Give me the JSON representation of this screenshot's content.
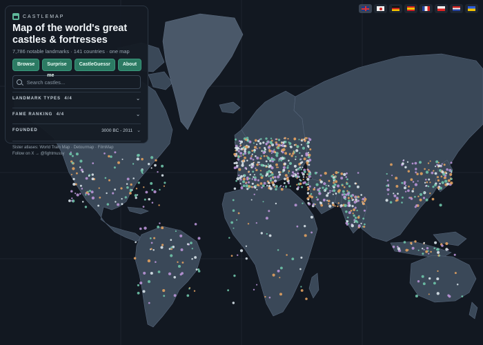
{
  "brand": {
    "name": "CASTLEMAP",
    "icon": "castle-icon"
  },
  "panel": {
    "title": "Map of the world's great castles & fortresses",
    "subtitle": "7,786 notable landmarks · 141 countries · one map",
    "buttons": [
      "Browse",
      "Surprise me",
      "CastleGuessr",
      "About"
    ],
    "search_placeholder": "Search castles...",
    "filters": [
      {
        "label": "LANDMARK TYPES",
        "value": "4/4"
      },
      {
        "label": "FAME RANKING",
        "value": "4/4"
      },
      {
        "label": "FOUNDED",
        "value": "3000 BC - 2011"
      }
    ],
    "footer_line1": "Sister atlases: World Train Map · Detourmap · FilmMap",
    "footer_line2": "Follow on X → @fightmussy"
  },
  "languages": [
    {
      "code": "en",
      "icon": "uk-flag-icon",
      "active": true
    },
    {
      "code": "ja",
      "icon": "japan-flag-icon"
    },
    {
      "code": "de",
      "icon": "germany-flag-icon"
    },
    {
      "code": "es",
      "icon": "spain-flag-icon"
    },
    {
      "code": "fr",
      "icon": "france-flag-icon"
    },
    {
      "code": "pl",
      "icon": "poland-flag-icon"
    },
    {
      "code": "nl",
      "icon": "netherlands-flag-icon"
    },
    {
      "code": "ua",
      "icon": "ukraine-flag-icon"
    }
  ],
  "colors": {
    "background": "#121821",
    "land": "#3a4858",
    "accent": "#2c7a63",
    "marker_palette": [
      "#d9e3ea",
      "#e0a060",
      "#b993d6",
      "#6fc3a8"
    ]
  }
}
